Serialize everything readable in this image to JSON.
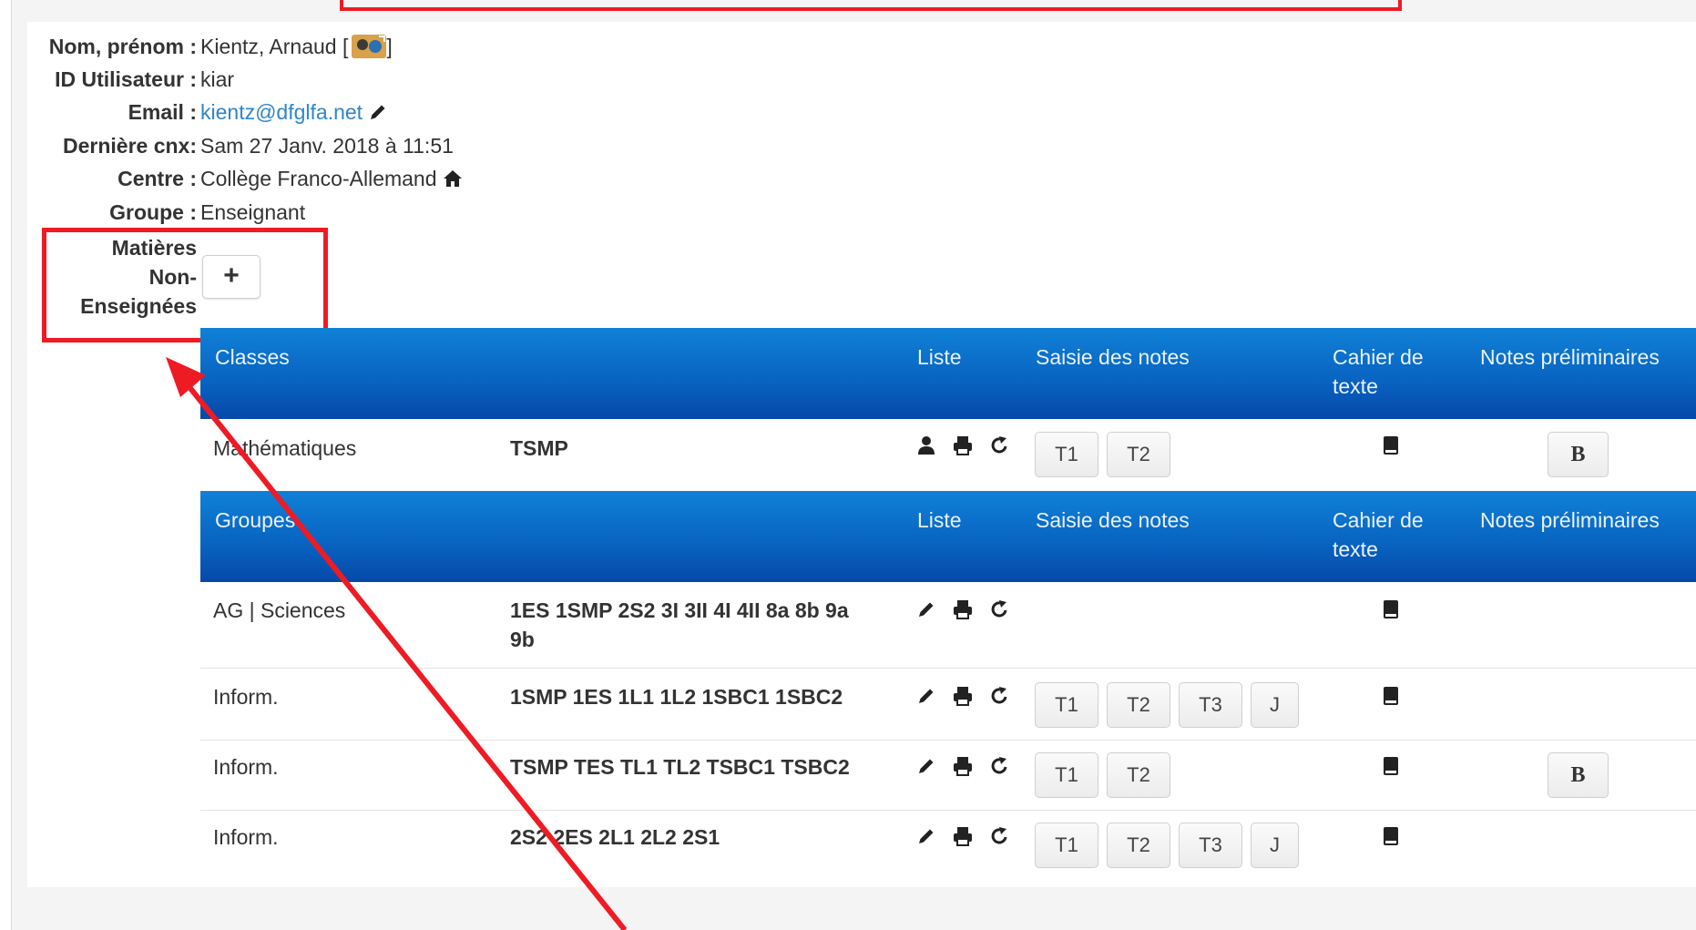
{
  "profile": {
    "name_label": "Nom, prénom :",
    "name_value": "Kientz, Arnaud [",
    "name_suffix": "]",
    "userid_label": "ID Utilisateur :",
    "userid_value": "kiar",
    "email_label": "Email :",
    "email_value": "kientz@dfglfa.net",
    "lastcnx_label": "Dernière cnx:",
    "lastcnx_value": "Sam 27 Janv. 2018 à 11:51",
    "centre_label": "Centre :",
    "centre_value": "Collège Franco-Allemand",
    "groupe_label": "Groupe :",
    "groupe_value": "Enseignant",
    "matieres_line1": "Matières",
    "matieres_line2": "Non-",
    "matieres_line3": "Enseignées",
    "plus_label": "+"
  },
  "classes_header": {
    "title": "Classes",
    "liste": "Liste",
    "saisie": "Saisie des notes",
    "cahier_line1": "Cahier de",
    "cahier_line2": "texte",
    "notes_prelim": "Notes préliminaires"
  },
  "groupes_header": {
    "title": "Groupes",
    "liste": "Liste",
    "saisie": "Saisie des notes",
    "cahier_line1": "Cahier de",
    "cahier_line2": "texte",
    "notes_prelim": "Notes préliminaires"
  },
  "classes_rows": [
    {
      "subject": "Mathématiques",
      "classes": "TSMP",
      "btns": [
        "T1",
        "T2"
      ],
      "b": "B"
    }
  ],
  "groupes_rows": [
    {
      "subject": "AG | Sciences",
      "classes_l1": "1ES 1SMP 2S2 3I 3II 4I 4II 8a 8b 9a",
      "classes_l2": "9b"
    },
    {
      "subject": "Inform.",
      "classes": "1SMP 1ES 1L1 1L2 1SBC1 1SBC2",
      "btns": [
        "T1",
        "T2",
        "T3",
        "J"
      ]
    },
    {
      "subject": "Inform.",
      "classes": "TSMP TES TL1 TL2 TSBC1 TSBC2",
      "btns": [
        "T1",
        "T2"
      ],
      "b": "B"
    },
    {
      "subject": "Inform.",
      "classes": "2S2 2ES 2L1 2L2 2S1",
      "btns": [
        "T1",
        "T2",
        "T3",
        "J"
      ]
    }
  ],
  "colors": {
    "header_blue": "#0862c0",
    "annotation_red": "#ee1b24",
    "link_blue": "#2f86c9"
  }
}
